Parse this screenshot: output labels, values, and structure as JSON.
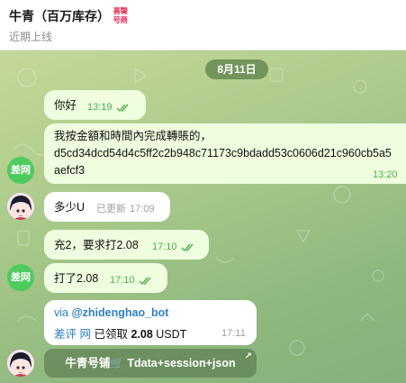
{
  "header": {
    "title": "牛青（百万库存）",
    "badge_line1": "喜聲",
    "badge_line2": "号商",
    "status": "近期上线"
  },
  "chat": {
    "date": "8月11日",
    "messages": [
      {
        "text": "你好",
        "time": "13:19"
      },
      {
        "line1": "我按金額和時間內完成轉賬的，",
        "line2": "d5cd34dcd54d4c5ff2c2b948c71173c9bdadd53c0606d21c960cb5a5",
        "line3": "aefcf3",
        "time": "13:20"
      },
      {
        "avatar_label": "差网"
      },
      {
        "text": "多少U",
        "edited": "已更新",
        "time": "17:09"
      },
      {
        "text": "充2，要求打2.08",
        "time": "17:10"
      },
      {
        "avatar_label": "差网"
      },
      {
        "text": "打了2.08",
        "time": "17:10"
      }
    ],
    "bot_card": {
      "via_prefix": "via ",
      "via_bot": "@zhidenghao_bot",
      "line_blue": "差评 网",
      "line_rest": " 已领取 ",
      "line_amount": "2.08",
      "line_unit": " USDT",
      "time": "17:11"
    },
    "inline_button": {
      "label": "牛青号铺🛒 Tdata+session+json",
      "arrow": "↗"
    }
  },
  "colors": {
    "outgoing_bubble": "#eefedf",
    "incoming_bubble": "#ffffff",
    "check": "#4fae4e",
    "link": "#2f7fbf",
    "avatar_green": "#4ecb5f"
  }
}
